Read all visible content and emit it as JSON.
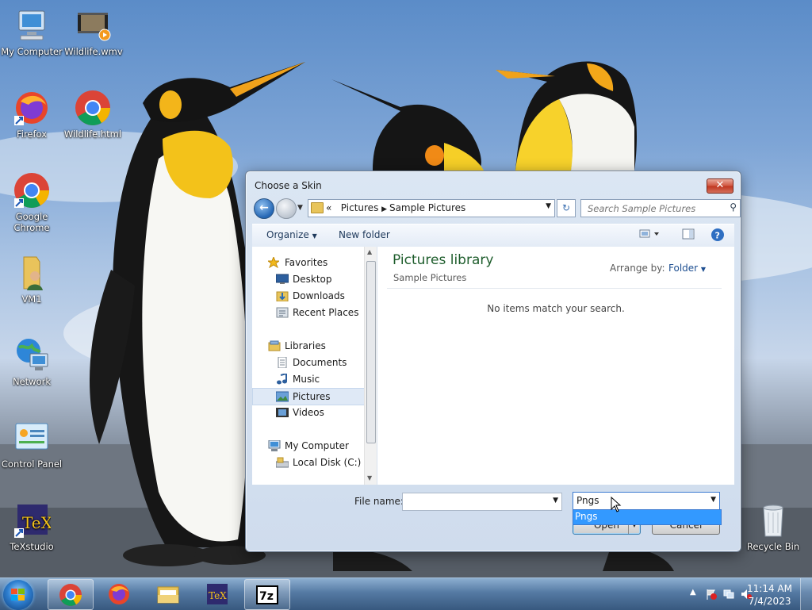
{
  "desktop": {
    "icons": [
      {
        "label": "My Computer",
        "icon": "computer-icon"
      },
      {
        "label": "Wildlife.wmv",
        "icon": "video-file-icon"
      },
      {
        "label": "Firefox",
        "icon": "firefox-icon"
      },
      {
        "label": "Wildlife.html",
        "icon": "chrome-icon"
      },
      {
        "label": "Google Chrome",
        "icon": "chrome-icon"
      },
      {
        "label": "VM1",
        "icon": "user-folder-icon"
      },
      {
        "label": "Network",
        "icon": "network-icon"
      },
      {
        "label": "Control Panel",
        "icon": "control-panel-icon"
      },
      {
        "label": "TeXstudio",
        "icon": "texstudio-icon"
      },
      {
        "label": "Recycle Bin",
        "icon": "recycle-bin-icon"
      }
    ]
  },
  "dialog": {
    "title": "Choose a Skin",
    "close_label": "✕",
    "address": {
      "prefix": "«",
      "crumbs": [
        "Pictures",
        "Sample Pictures"
      ]
    },
    "search": {
      "placeholder": "Search Sample Pictures"
    },
    "toolbar": {
      "organize": "Organize",
      "new_folder": "New folder"
    },
    "nav": {
      "favorites": {
        "label": "Favorites",
        "items": [
          "Desktop",
          "Downloads",
          "Recent Places"
        ]
      },
      "libraries": {
        "label": "Libraries",
        "items": [
          "Documents",
          "Music",
          "Pictures",
          "Videos"
        ]
      },
      "computer": {
        "label": "My Computer",
        "items": [
          "Local Disk (C:)"
        ]
      },
      "selected": "Pictures"
    },
    "main": {
      "title": "Pictures library",
      "subtitle": "Sample Pictures",
      "arrange_label": "Arrange by:",
      "arrange_value": "Folder",
      "empty_message": "No items match your search."
    },
    "bottom": {
      "file_name_label": "File name:",
      "file_name_value": "",
      "file_type_value": "Pngs",
      "file_type_options": [
        "Pngs"
      ],
      "open_label": "Open",
      "cancel_label": "Cancel"
    }
  },
  "taskbar": {
    "apps": [
      "chrome",
      "firefox",
      "file-explorer",
      "texstudio",
      "7zip"
    ],
    "active_app": "7zip",
    "clock": {
      "time": "11:14 AM",
      "date": "7/4/2023"
    }
  },
  "colors": {
    "accent": "#3399ff",
    "library_title": "#1e5d2c",
    "link": "#1e4f91"
  }
}
